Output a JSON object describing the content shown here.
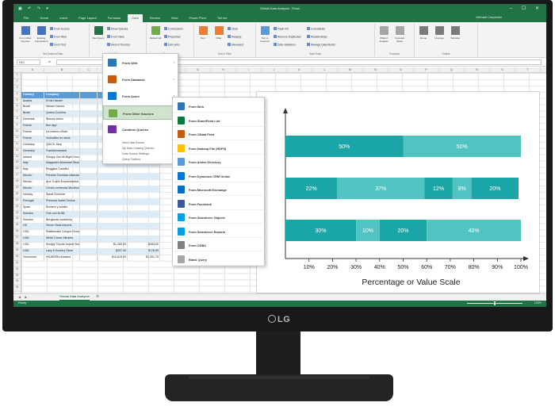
{
  "app": {
    "title": "Global Data Analysis - Excel",
    "user": "Michael Carpenter",
    "window_controls": "– ☐ ✕",
    "quick_access": "▣ ↶ ↷ ▾"
  },
  "tabs": [
    "File",
    "Home",
    "Insert",
    "Page Layout",
    "Formulas",
    "Data",
    "Review",
    "View",
    "Power Pivot",
    "Tell me"
  ],
  "active_tab": "Data",
  "ribbon": {
    "groups": [
      {
        "label": "Get External Data",
        "buttons": [
          "From Access",
          "From Web",
          "From Text"
        ],
        "big": [
          "From Other Sources",
          "Existing Connections"
        ]
      },
      {
        "label": "Get & Transform",
        "big": [
          "New Query"
        ],
        "buttons": [
          "Show Queries",
          "From Table",
          "Recent Sources"
        ]
      },
      {
        "label": "Connections",
        "big": [
          "Refresh All"
        ],
        "buttons": [
          "Connections",
          "Properties",
          "Edit Links"
        ]
      },
      {
        "label": "Sort & Filter",
        "big": [
          "Sort",
          "Filter"
        ],
        "buttons": [
          "Clear",
          "Reapply",
          "Advanced"
        ]
      },
      {
        "label": "Data Tools",
        "big": [
          "Text to Columns"
        ],
        "buttons": [
          "Flash Fill",
          "Remove Duplicates",
          "Data Validation",
          "Consolidate",
          "Relationships",
          "Manage Data Model"
        ]
      },
      {
        "label": "Forecast",
        "big": [
          "What-If Analysis",
          "Forecast Sheet"
        ]
      },
      {
        "label": "Outline",
        "big": [
          "Group",
          "Ungroup",
          "Subtotal"
        ]
      }
    ]
  },
  "formula_bar": {
    "name_box": "H10",
    "fx": "fx",
    "value": ""
  },
  "columns": [
    "A",
    "B",
    "C",
    "D",
    "E",
    "F",
    "G",
    "H",
    "I",
    "J",
    "K",
    "L",
    "M",
    "N",
    "O",
    "P",
    "Q",
    "R",
    "S",
    "T"
  ],
  "table": {
    "headers": [
      "Country",
      "Company",
      "",
      "",
      ""
    ],
    "rows": [
      [
        "Austria",
        "Ernst Handel",
        "",
        "",
        ""
      ],
      [
        "Brazil",
        "Hanari Carnes",
        "",
        "",
        ""
      ],
      [
        "Brazil",
        "Queen Cozinha",
        "",
        "",
        ""
      ],
      [
        "Denmark",
        "Simons bistro",
        "",
        "",
        ""
      ],
      [
        "France",
        "Bon app'",
        "",
        "",
        ""
      ],
      [
        "France",
        "La maison d'Asie",
        "",
        "",
        ""
      ],
      [
        "France",
        "Victuailles en stock",
        "",
        "",
        ""
      ],
      [
        "Germany",
        "QUICK-Stop",
        "",
        "",
        ""
      ],
      [
        "Germany",
        "Frankenversand",
        "",
        "",
        ""
      ],
      [
        "Ireland",
        "Hungry Owl All-Night Grocers",
        "",
        "",
        ""
      ],
      [
        "Italy",
        "Magazzini Alimentari Riuniti",
        "",
        "",
        ""
      ],
      [
        "Italy",
        "Reggiani Caseifici",
        "",
        "",
        ""
      ],
      [
        "Mexico",
        "Pericles Comidas clásicas",
        "",
        "",
        ""
      ],
      [
        "Mexico",
        "Ana Trujillo Emparedados",
        "",
        "",
        ""
      ],
      [
        "Mexico",
        "Centro comercial Moctezuma",
        "",
        "",
        ""
      ],
      [
        "Norway",
        "Santé Gourmet",
        "",
        "",
        ""
      ],
      [
        "Portugal",
        "Princesa Isabel Vinhos",
        "",
        "",
        ""
      ],
      [
        "Spain",
        "Romero y tomillo",
        "",
        "",
        ""
      ],
      [
        "Sweden",
        "Folk och fä HB",
        "",
        "",
        ""
      ],
      [
        "Sweden",
        "Berglunds snabbköp",
        "",
        "",
        ""
      ],
      [
        "UK",
        "Seven Seas Imports",
        "",
        "",
        ""
      ],
      [
        "USA",
        "Rattlesnake Canyon Grocery",
        "",
        "",
        ""
      ],
      [
        "USA",
        "White Clover Markets",
        "",
        "",
        ""
      ],
      [
        "USA",
        "Hungry Coyote Import Store",
        "",
        "$1,260.00",
        "$283.50"
      ],
      [
        "USA",
        "Lazy K Kountry Store",
        "",
        "$357.00",
        "$178.50"
      ],
      [
        "Venezuela",
        "HILARIÓN-Abastos",
        "",
        "$10,815.00",
        "$1,351.75"
      ]
    ]
  },
  "menu_level1": {
    "items": [
      {
        "label": "From Web",
        "active": false
      },
      {
        "label": "From Database",
        "active": false
      },
      {
        "label": "From Azure",
        "active": false
      },
      {
        "label": "From Other Sources",
        "active": true
      },
      {
        "label": "Combine Queries",
        "active": false
      }
    ],
    "plain": [
      "New Data Source",
      "My Data Catalog Queries",
      "Data Source Settings...",
      "Query Options"
    ]
  },
  "menu_level2": {
    "items": [
      "From Web",
      "From SharePoint List",
      "From OData Feed",
      "From Hadoop File (HDFS)",
      "From Active Directory",
      "From Dynamics CRM Online",
      "From Microsoft Exchange",
      "From Facebook",
      "From Salesforce Objects",
      "From Salesforce Reports",
      "From ODBC",
      "Blank Query"
    ]
  },
  "colors": {
    "excel_green": "#217346",
    "bar_dark": "#1aa6a6",
    "bar_light": "#52c3c3",
    "header_blue": "#5b9bd5",
    "active_menu": "#cfe3cf"
  },
  "icons": {
    "menu": [
      "globe-icon",
      "database-icon",
      "azure-icon",
      "other-sources-icon",
      "combine-icon"
    ],
    "submenu": [
      "globe-icon",
      "sharepoint-icon",
      "odata-icon",
      "hadoop-icon",
      "directory-icon",
      "dynamics-icon",
      "exchange-icon",
      "facebook-icon",
      "salesforce-icon",
      "salesforce-icon",
      "odbc-icon",
      "blank-query-icon"
    ]
  },
  "chart_data": {
    "type": "bar",
    "orientation": "horizontal-stacked",
    "xlabel": "Percentage or Value Scale",
    "ylabel": "",
    "title": "",
    "xlim": [
      0,
      100
    ],
    "xticks": [
      "10%",
      "20%",
      "30%",
      "40%",
      "50%",
      "60%",
      "70%",
      "80%",
      "90%",
      "100%"
    ],
    "bars": [
      {
        "segments": [
          50,
          50
        ],
        "labels": [
          "50%",
          "50%"
        ]
      },
      {
        "segments": [
          22,
          37,
          12,
          8,
          20
        ],
        "labels": [
          "22%",
          "37%",
          "12%",
          "8%",
          "20%"
        ]
      },
      {
        "segments": [
          30,
          10,
          20,
          40
        ],
        "labels": [
          "30%",
          "10%",
          "20%",
          "40%"
        ]
      }
    ],
    "grid": false,
    "legend": "none"
  },
  "sheet": {
    "nav": "◀ ▶",
    "tab": "Global Data Analysis",
    "add": "⊕"
  },
  "status": {
    "text": "Ready",
    "zoom": "100%"
  },
  "hardware": {
    "logo": "LG"
  }
}
